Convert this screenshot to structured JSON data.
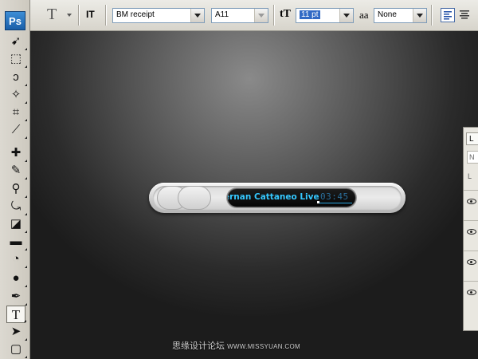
{
  "app": {
    "logo": "Ps"
  },
  "options_bar": {
    "tool_icon": "T",
    "orientation_icon": "IT",
    "font_family": "BM receipt",
    "font_style": "A11",
    "font_size_icon": "tT",
    "font_size": "11 pt",
    "antialias_icon": "aa",
    "antialias": "None",
    "align_left_icon": "align-left-icon",
    "align_center_icon": "align-center-icon"
  },
  "toolbox": {
    "tools": [
      {
        "name": "move-tool-icon",
        "glyph": "➹"
      },
      {
        "name": "marquee-tool-icon",
        "glyph": "⬚"
      },
      {
        "name": "lasso-tool-icon",
        "glyph": "ↄ"
      },
      {
        "name": "magic-wand-tool-icon",
        "glyph": "✧"
      },
      {
        "name": "crop-tool-icon",
        "glyph": "⌗"
      },
      {
        "name": "eyedropper-tool-icon",
        "glyph": "⟋"
      },
      {
        "name": "healing-brush-tool-icon",
        "glyph": "✚"
      },
      {
        "name": "brush-tool-icon",
        "glyph": "✎"
      },
      {
        "name": "clone-stamp-tool-icon",
        "glyph": "⚲"
      },
      {
        "name": "history-brush-tool-icon",
        "glyph": "⤿"
      },
      {
        "name": "eraser-tool-icon",
        "glyph": "◪"
      },
      {
        "name": "gradient-tool-icon",
        "glyph": "▬"
      },
      {
        "name": "blur-tool-icon",
        "glyph": "◔"
      },
      {
        "name": "dodge-tool-icon",
        "glyph": "●"
      },
      {
        "name": "pen-tool-icon",
        "glyph": "✒"
      },
      {
        "name": "type-tool-icon",
        "glyph": "T"
      },
      {
        "name": "path-selection-tool-icon",
        "glyph": "➤"
      },
      {
        "name": "shape-tool-icon",
        "glyph": "▢"
      }
    ]
  },
  "player": {
    "track": "ernan Cattaneo Live",
    "time": "03:45"
  },
  "layers_panel": {
    "tab_label": "L",
    "search": "N",
    "lock_label": "L"
  },
  "watermark": {
    "cn_text": "思缘设计论坛",
    "url": "WWW.MISSYUAN.COM"
  },
  "colors": {
    "track_text": "#35c8ff",
    "selection": "#316ac5"
  }
}
